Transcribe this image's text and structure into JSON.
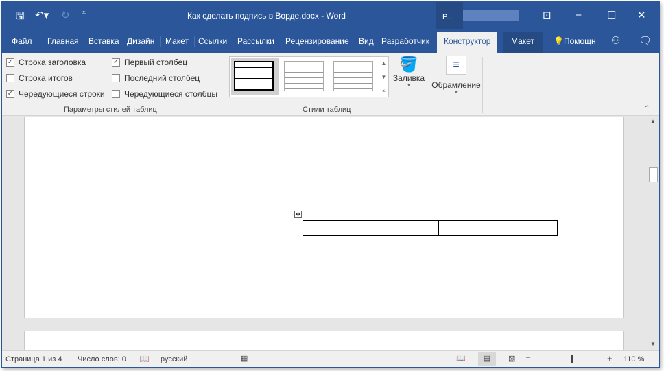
{
  "window": {
    "title": "Как сделать подпись в Ворде.docx - Word",
    "account_initial": "Р..."
  },
  "tabs": [
    "Файл",
    "Главная",
    "Вставка",
    "Дизайн",
    "Макет",
    "Ссылки",
    "Рассылки",
    "Рецензирование",
    "Вид",
    "Разработчик",
    "Конструктор",
    "Макет"
  ],
  "help": "Помощн",
  "options": {
    "header_row": "Строка заголовка",
    "total_row": "Строка итогов",
    "banded_rows": "Чередующиеся строки",
    "first_column": "Первый столбец",
    "last_column": "Последний столбец",
    "banded_columns": "Чередующиеся столбцы",
    "group_label": "Параметры стилей таблиц"
  },
  "styles": {
    "group_label": "Стили таблиц",
    "shading": "Заливка",
    "borders": "Обрамление"
  },
  "status": {
    "page": "Страница 1 из 4",
    "words": "Число слов: 0",
    "language": "русский",
    "zoom": "110 %"
  },
  "checks": {
    "header_row": true,
    "total_row": false,
    "banded_rows": true,
    "first_column": true,
    "last_column": false,
    "banded_columns": false
  }
}
